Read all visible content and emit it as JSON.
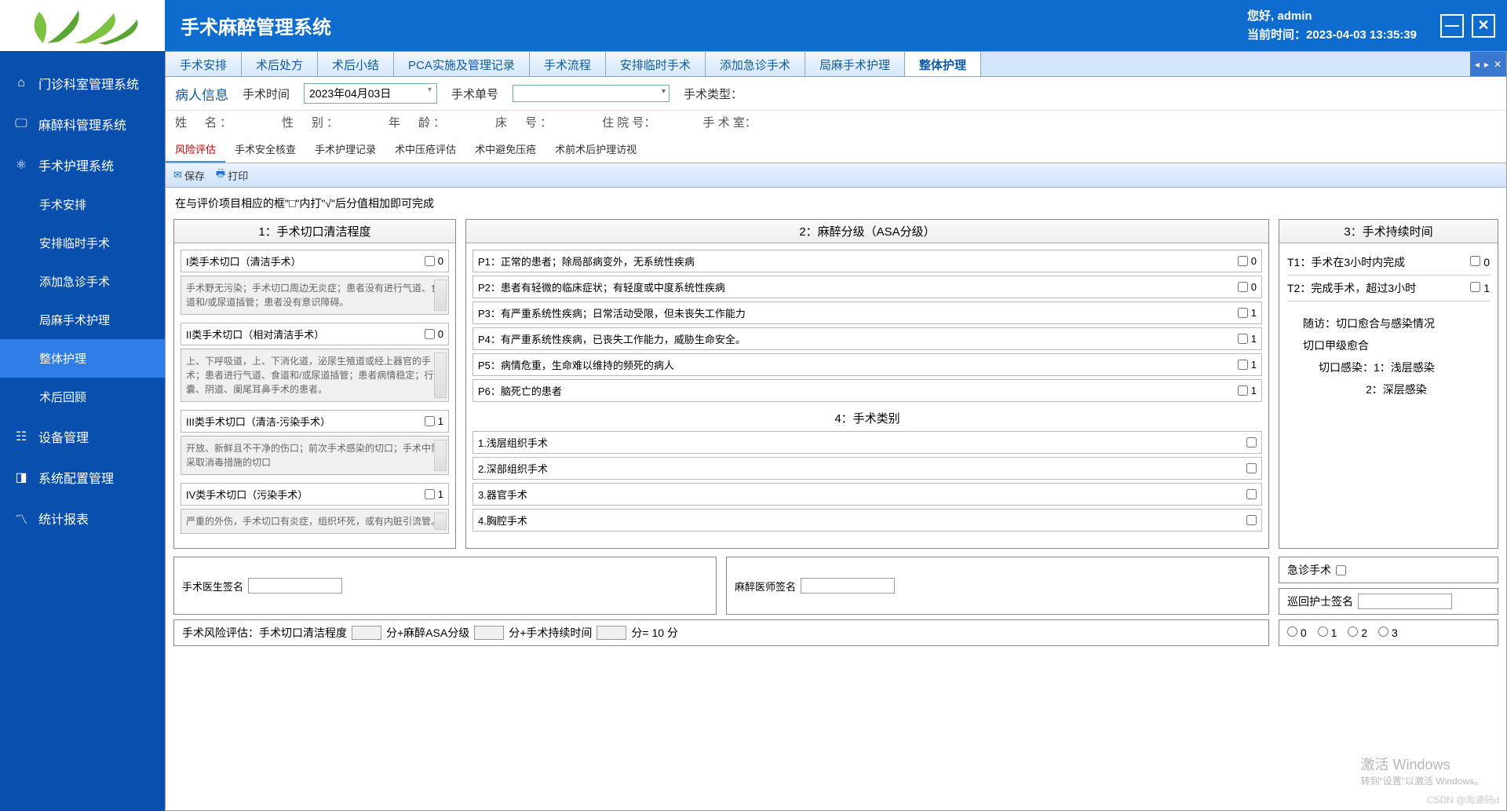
{
  "header": {
    "app_title": "手术麻醉管理系统",
    "greeting": "您好, admin",
    "time_label": "当前时间：",
    "time_value": "2023-04-03 13:35:39"
  },
  "sidebar": {
    "items": [
      {
        "label": "门诊科室管理系统"
      },
      {
        "label": "麻醉科管理系统"
      },
      {
        "label": "手术护理系统"
      },
      {
        "label": "设备管理"
      },
      {
        "label": "系统配置管理"
      },
      {
        "label": "统计报表"
      }
    ],
    "subs": [
      {
        "label": "手术安排"
      },
      {
        "label": "安排临时手术"
      },
      {
        "label": "添加急诊手术"
      },
      {
        "label": "局麻手术护理"
      },
      {
        "label": "整体护理"
      },
      {
        "label": "术后回顾"
      }
    ]
  },
  "tabs": [
    "手术安排",
    "术后处方",
    "术后小结",
    "PCA实施及管理记录",
    "手术流程",
    "安排临时手术",
    "添加急诊手术",
    "局麻手术护理",
    "整体护理"
  ],
  "info": {
    "title": "病人信息",
    "op_time_label": "手术时间",
    "op_time_value": "2023年04月03日",
    "op_no_label": "手术单号",
    "op_type_label": "手术类型：",
    "row2": [
      "姓　名：",
      "性　别：",
      "年　龄：",
      "床　号：",
      "住 院 号：",
      "手 术 室："
    ]
  },
  "subtabs": [
    "风险评估",
    "手术安全核查",
    "手术护理记录",
    "术中压疮评估",
    "术中避免压疮",
    "术前术后护理访视"
  ],
  "toolbar": {
    "save": "保存",
    "print": "打印"
  },
  "hint": "在与评价项目相应的框\"□\"内打\"√\"后分值相加即可完成",
  "panel1": {
    "title": "1：手术切口清洁程度",
    "items": [
      {
        "h": "I类手术切口（清洁手术）",
        "v": "0",
        "d": "手术野无污染；手术切口周边无炎症；患者没有进行气道、食道和/或尿道插管；患者没有意识障碍。"
      },
      {
        "h": "II类手术切口（相对清洁手术）",
        "v": "0",
        "d": "上、下呼吸道，上、下消化道，泌尿生殖道或经上器官的手术；患者进行气道、食道和/或尿道插管；患者病情稳定；行胆囊、阴道、阑尾耳鼻手术的患者。"
      },
      {
        "h": "III类手术切口（清洁-污染手术）",
        "v": "1",
        "d": "开放、新鲜且不干净的伤口；前次手术感染的切口；手术中需采取消毒措施的切口"
      },
      {
        "h": "IV类手术切口（污染手术）",
        "v": "1",
        "d": "严重的外伤，手术切口有炎症，组织坏死，或有内脏引流管。"
      }
    ]
  },
  "panel2": {
    "title": "2：麻醉分级（ASA分级）",
    "items": [
      {
        "h": "P1：正常的患者；除局部病变外，无系统性疾病",
        "v": "0"
      },
      {
        "h": "P2：患者有轻微的临床症状；有轻度或中度系统性疾病",
        "v": "0"
      },
      {
        "h": "P3：有严重系统性疾病；日常活动受限，但未丧失工作能力",
        "v": "1"
      },
      {
        "h": "P4：有严重系统性疾病，已丧失工作能力，威胁生命安全。",
        "v": "1"
      },
      {
        "h": "P5：病情危重，生命难以维持的频死的病人",
        "v": "1"
      },
      {
        "h": "P6：脑死亡的患者",
        "v": "1"
      }
    ],
    "sub_title": "4：手术类别",
    "cats": [
      "1.浅层组织手术",
      "2.深部组织手术",
      "3.器官手术",
      "4.胸腔手术"
    ]
  },
  "panel3": {
    "title": "3：手术持续时间",
    "t1": {
      "label": "T1：手术在3小时内完成",
      "v": "0"
    },
    "t2": {
      "label": "T2：完成手术，超过3小时",
      "v": "1"
    },
    "followup": "随访：切口愈合与感染情况",
    "heal": "切口甲级愈合",
    "inf_label": "切口感染：",
    "inf1": "1：浅层感染",
    "inf2": "2：深层感染",
    "emergency": "急诊手术",
    "nurse_sig": "巡回护士签名"
  },
  "sig": {
    "surgeon": "手术医生签名",
    "anes": "麻醉医师签名"
  },
  "summary": {
    "label": "手术风险评估：手术切口清洁程度",
    "p1": "分+麻醉ASA分级",
    "p2": "分+手术持续时间",
    "p3": "分= 10 分",
    "radios": [
      "0",
      "1",
      "2",
      "3"
    ]
  },
  "watermark": {
    "l1": "激活 Windows",
    "l2": "转到\"设置\"以激活 Windows。"
  },
  "csdn": "CSDN @淘源码d"
}
